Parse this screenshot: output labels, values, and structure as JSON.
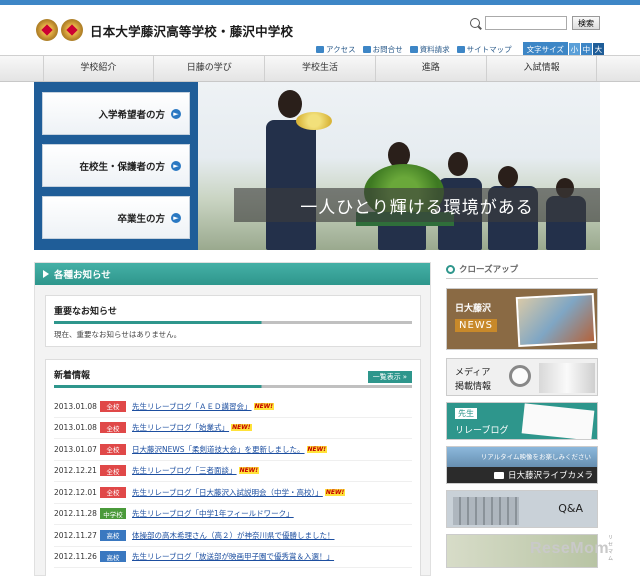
{
  "header": {
    "school_name": "日本大学藤沢高等学校・藤沢中学校",
    "search_button": "検索",
    "util_links": [
      "アクセス",
      "お問合せ",
      "資料請求",
      "サイトマップ"
    ],
    "font_size_label": "文字サイズ",
    "font_sizes": [
      "小",
      "中",
      "大"
    ]
  },
  "nav": {
    "items": [
      "学校紹介",
      "日藤の学び",
      "学校生活",
      "進路",
      "入試情報"
    ]
  },
  "hero": {
    "buttons": [
      "入学希望者の方",
      "在校生・保護者の方",
      "卒業生の方"
    ],
    "caption": "一人ひとり輝ける環境がある"
  },
  "notice": {
    "title": "各種お知らせ",
    "important_title": "重要なお知らせ",
    "important_text": "現在、重要なお知らせはありません。",
    "news_title": "新着情報",
    "more_label": "一覧表示",
    "new_tag": "NEW!",
    "items": [
      {
        "date": "2013.01.08",
        "badge": "全校",
        "title": "先生リレーブログ「ＡＥＤ講習会」",
        "new": true,
        "kind": "all"
      },
      {
        "date": "2013.01.08",
        "badge": "全校",
        "title": "先生リレーブログ「始業式」",
        "new": true,
        "kind": "all"
      },
      {
        "date": "2013.01.07",
        "badge": "全校",
        "title": "日大藤沢NEWS「柔剣道技大会」を更新しました。",
        "new": true,
        "kind": "all"
      },
      {
        "date": "2012.12.21",
        "badge": "全校",
        "title": "先生リレーブログ「三者面談」",
        "new": true,
        "kind": "all"
      },
      {
        "date": "2012.12.01",
        "badge": "全校",
        "title": "先生リレーブログ「日大藤沢入試説明会（中学・高校）」",
        "new": true,
        "kind": "all"
      },
      {
        "date": "2012.11.28",
        "badge": "中学校",
        "title": "先生リレーブログ「中学1年フィールドワーク」",
        "new": false,
        "kind": "jr"
      },
      {
        "date": "2012.11.27",
        "badge": "高校",
        "title": "体操部の高木希理さん（高２）が神奈川県で優勝しました！",
        "new": false,
        "kind": "hi"
      },
      {
        "date": "2012.11.26",
        "badge": "高校",
        "title": "先生リレーブログ「放送部が映画甲子園で優秀賞＆入選！」",
        "new": false,
        "kind": "hi"
      }
    ]
  },
  "closeup": {
    "title": "クローズアップ",
    "news_banner": [
      "日大藤沢",
      "NEWS"
    ],
    "media_banner": [
      "メディア",
      "掲載情報"
    ],
    "relay_banner": [
      "先生",
      "リレーブログ"
    ],
    "camera_banner": [
      "リアルタイム映像をお楽しみください",
      "日大藤沢ライブカメラ"
    ],
    "qa_banner": "Q&A"
  },
  "watermark": {
    "text": "ReseMom",
    "sub": "リセマム"
  },
  "colors": {
    "accent": "#3d86c6",
    "teal": "#2e968c",
    "navy": "#1f5d98"
  }
}
